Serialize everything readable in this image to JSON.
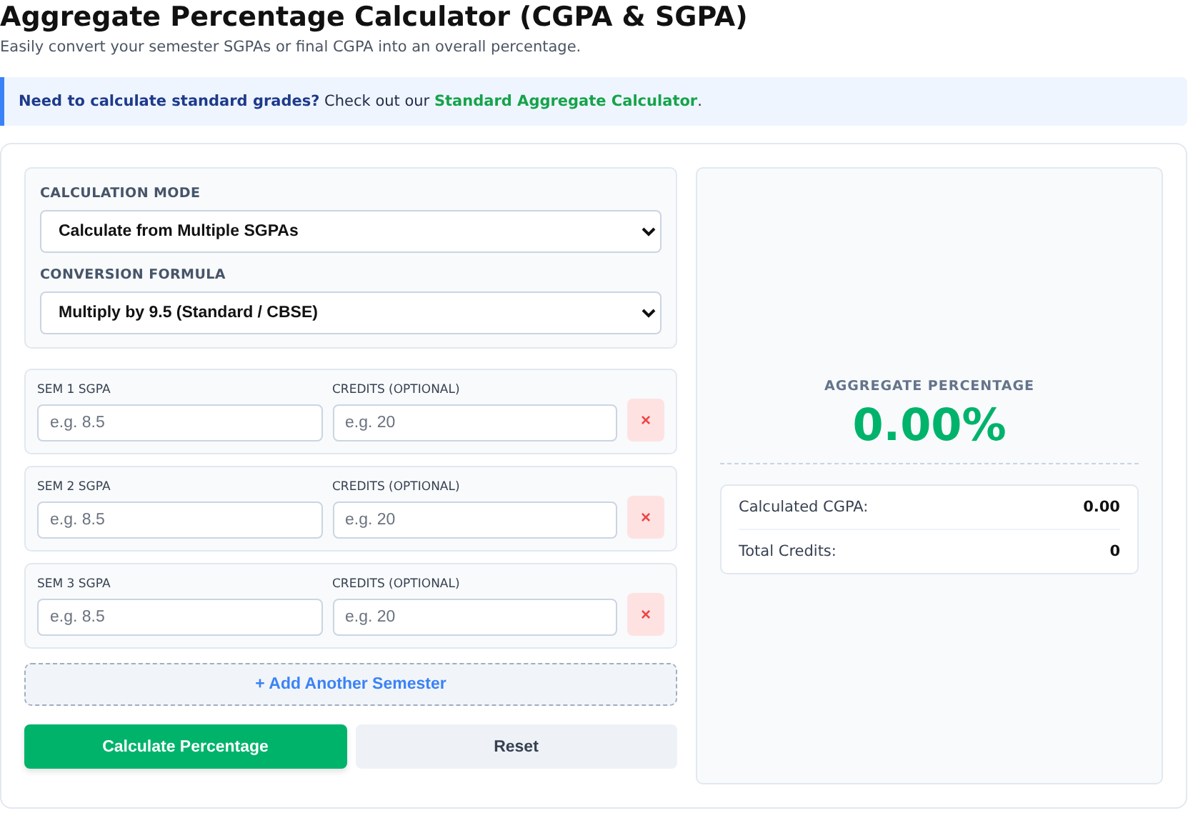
{
  "title": "Aggregate Percentage Calculator (CGPA & SGPA)",
  "subtitle": "Easily convert your semester SGPAs or final CGPA into an overall percentage.",
  "notice": {
    "text": "**Need to calculate standard grades?** Check out our ",
    "link": "Standard Aggregate Calculator",
    "after": "."
  },
  "settings": [
    {
      "label": "CALCULATION MODE",
      "value": "Calculate from Multiple SGPAs"
    },
    {
      "label": "CONVERSION FORMULA",
      "value": "Multiply by 9.5 (Standard / CBSE)"
    }
  ],
  "semesters": [
    {
      "sgpa_label": "SEM 1 SGPA",
      "sgpa_placeholder": "e.g. 8.5",
      "credits_label": "CREDITS (OPTIONAL)",
      "credits_placeholder": "e.g. 20",
      "remove": "×"
    },
    {
      "sgpa_label": "SEM 2 SGPA",
      "sgpa_placeholder": "e.g. 8.5",
      "credits_label": "CREDITS (OPTIONAL)",
      "credits_placeholder": "e.g. 20",
      "remove": "×"
    },
    {
      "sgpa_label": "SEM 3 SGPA",
      "sgpa_placeholder": "e.g. 8.5",
      "credits_label": "CREDITS (OPTIONAL)",
      "credits_placeholder": "e.g. 20",
      "remove": "×"
    }
  ],
  "add_button": "+ Add Another Semester",
  "buttons": [
    {
      "label": "Calculate Percentage",
      "kind": "primary"
    },
    {
      "label": "Reset",
      "kind": "secondary"
    }
  ],
  "result": {
    "label": "AGGREGATE PERCENTAGE",
    "value": "0.00%",
    "details": [
      {
        "label": "Calculated CGPA:",
        "value": "0.00"
      },
      {
        "label": "Total Credits:",
        "value": "0"
      }
    ]
  }
}
